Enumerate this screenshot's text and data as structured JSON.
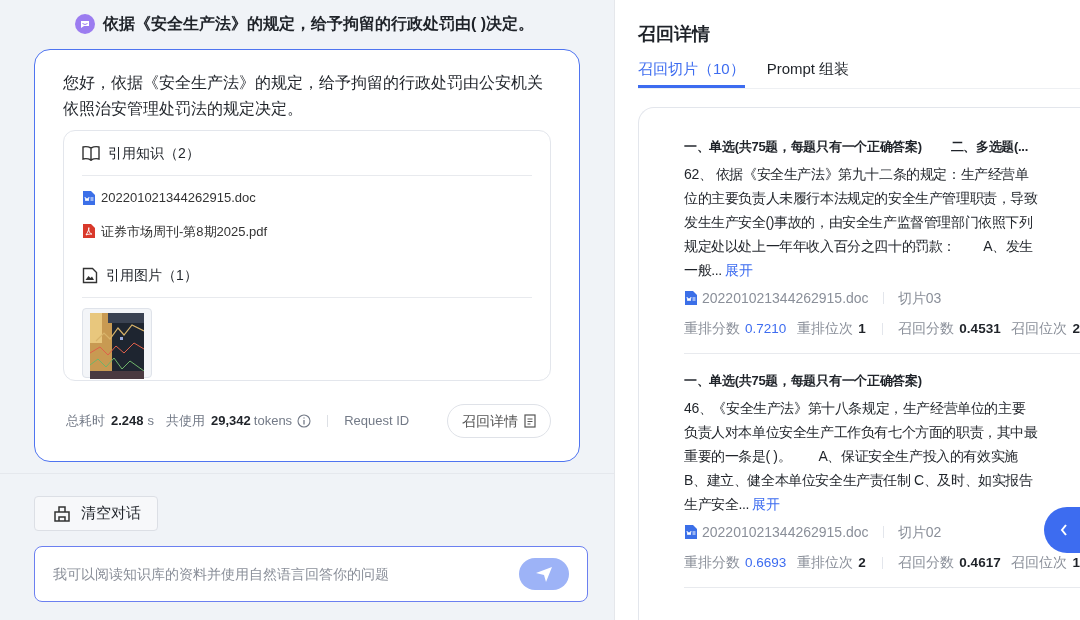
{
  "question": {
    "text": "依据《安全生产法》的规定，给予拘留的行政处罚由( )决定。"
  },
  "answer": {
    "text": "您好，依据《安全生产法》的规定，给予拘留的行政处罚由公安机关依照治安管理处罚法的规定决定。",
    "knowledge": {
      "title": "引用知识（2）",
      "files": [
        {
          "name": "202201021344262915.doc",
          "kind": "doc"
        },
        {
          "name": "证券市场周刊-第8期2025.pdf",
          "kind": "pdf"
        }
      ]
    },
    "images": {
      "title": "引用图片（1）"
    },
    "footer": {
      "time_label": "总耗时",
      "time_value": "2.248",
      "time_unit": "s",
      "tokens_label": "共使用",
      "tokens_value": "29,342",
      "tokens_unit": "tokens",
      "request_id": "Request ID",
      "details_button": "召回详情"
    }
  },
  "clear_button": "清空对话",
  "input": {
    "placeholder": "我可以阅读知识库的资料并使用自然语言回答你的问题"
  },
  "detail_panel": {
    "title": "召回详情",
    "tabs": [
      {
        "label": "召回切片（10）",
        "selected": true
      },
      {
        "label": "Prompt 组装",
        "selected": false
      }
    ],
    "chunks": [
      {
        "heading": "一、单选(共75题，每题只有一个正确答案)　　 二、多选题(...",
        "text": "62、 依据《安全生产法》第九十二条的规定：生产经营单位的主要负责人未履行本法规定的安全生产管理职责，导致发生生产安全()事故的，由安全生产监督管理部门依照下列规定处以处上一年年收入百分之四十的罚款：　　A、发生一般...",
        "more": "展开",
        "file": "202201021344262915.doc",
        "chunk": "切片03",
        "scores": [
          {
            "label": "重排分数",
            "value": "0.7210",
            "highlighted": true
          },
          {
            "label": "重排位次",
            "value": "1",
            "highlighted": false
          },
          {
            "label": "召回分数",
            "value": "0.4531",
            "highlighted": false
          },
          {
            "label": "召回位次",
            "value": "2",
            "highlighted": false
          }
        ]
      },
      {
        "heading": "一、单选(共75题，每题只有一个正确答案)",
        "text": "46、《安全生产法》第十八条规定，生产经营单位的主要负责人对本单位安全生产工作负有七个方面的职责，其中最重要的一条是( )。　　A、保证安全生产投入的有效实施 B、建立、健全本单位安全生产责任制 C、及时、如实报告生产安全...",
        "more": "展开",
        "file": "202201021344262915.doc",
        "chunk": "切片02",
        "scores": [
          {
            "label": "重排分数",
            "value": "0.6693",
            "highlighted": true
          },
          {
            "label": "重排位次",
            "value": "2",
            "highlighted": false
          },
          {
            "label": "召回分数",
            "value": "0.4617",
            "highlighted": false
          },
          {
            "label": "召回位次",
            "value": "1",
            "highlighted": false
          }
        ]
      }
    ]
  }
}
